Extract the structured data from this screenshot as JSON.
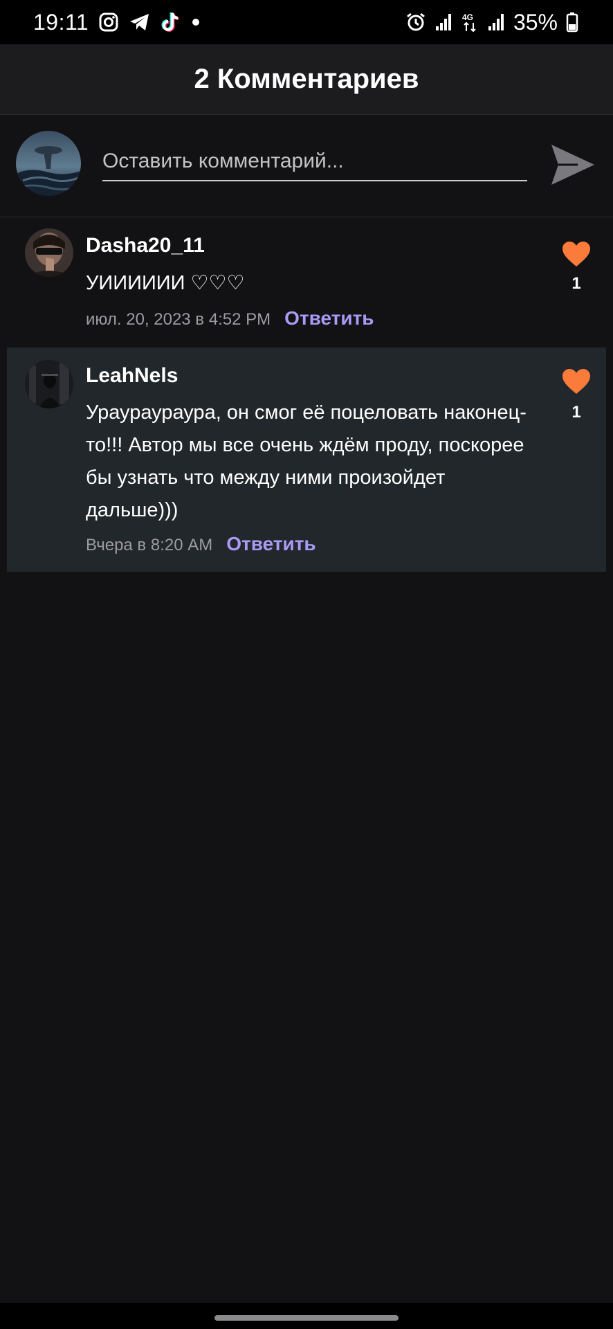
{
  "status_bar": {
    "time": "19:11",
    "battery_percent": "35%",
    "network": "4G",
    "left_icons": [
      "instagram-icon",
      "telegram-icon",
      "tiktok-icon",
      "dot-icon"
    ],
    "right_icons": [
      "alarm-icon",
      "signal-icon",
      "signal-icon",
      "battery-icon"
    ]
  },
  "header": {
    "title": "2 Комментариев"
  },
  "compose": {
    "placeholder": "Оставить комментарий...",
    "value": "",
    "send_icon": "send-icon"
  },
  "comments": [
    {
      "author": "Dasha20_11",
      "text": "УИИИИИИ ♡♡♡",
      "date": "июл. 20, 2023 в 4:52 PM",
      "reply_label": "Ответить",
      "likes": "1",
      "liked": true
    },
    {
      "author": "LeahNels",
      "text": "Ураураураура, он смог её поцеловать наконец-то!!! Автор мы все очень ждём проду, поскорее бы узнать что между ними произойдет дальше)))",
      "date": "Вчера в 8:20 AM",
      "reply_label": "Ответить",
      "likes": "1",
      "liked": true
    }
  ],
  "colors": {
    "background": "#121113",
    "header": "#1c1b1e",
    "highlight_row": "#21272b",
    "like": "#fa7b3a",
    "reply": "#a99af4",
    "meta": "#9c9ba1"
  }
}
